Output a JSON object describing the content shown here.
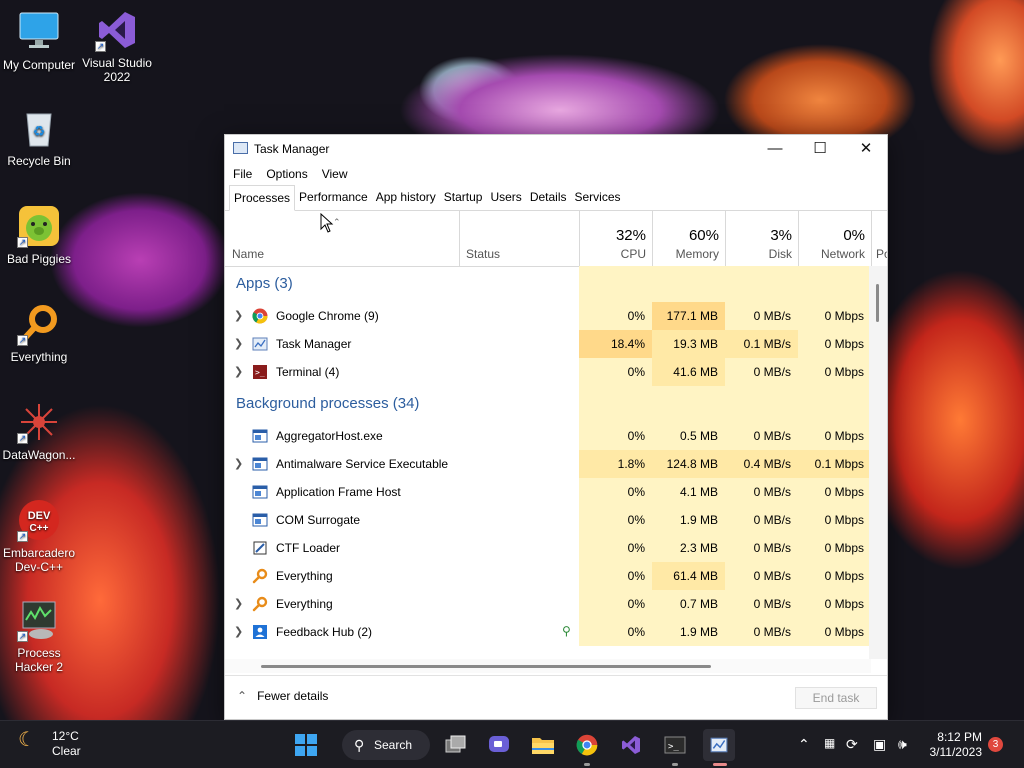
{
  "desktop": {
    "icons": [
      {
        "label": "My Computer"
      },
      {
        "label": "Visual Studio 2022"
      },
      {
        "label": "Recycle Bin"
      },
      {
        "label": "Bad Piggies"
      },
      {
        "label": "Everything"
      },
      {
        "label": "DataWagon..."
      },
      {
        "label": "Embarcadero Dev-C++"
      },
      {
        "label": "Process Hacker 2"
      }
    ]
  },
  "window": {
    "title": "Task Manager",
    "menu": [
      "File",
      "Options",
      "View"
    ],
    "tabs": [
      "Processes",
      "Performance",
      "App history",
      "Startup",
      "Users",
      "Details",
      "Services"
    ],
    "active_tab": "Processes",
    "columns": {
      "name": "Name",
      "status": "Status",
      "cpu": {
        "pct": "32%",
        "label": "CPU"
      },
      "memory": {
        "pct": "60%",
        "label": "Memory"
      },
      "disk": {
        "pct": "3%",
        "label": "Disk"
      },
      "network": {
        "pct": "0%",
        "label": "Network"
      },
      "power_partial": "Po"
    },
    "groups": {
      "apps": "Apps (3)",
      "background": "Background processes (34)"
    },
    "apps": [
      {
        "name": "Google Chrome (9)",
        "cpu": "0%",
        "mem": "177.1 MB",
        "disk": "0 MB/s",
        "net": "0 Mbps",
        "icon": "chrome-icon"
      },
      {
        "name": "Task Manager",
        "cpu": "18.4%",
        "mem": "19.3 MB",
        "disk": "0.1 MB/s",
        "net": "0 Mbps",
        "icon": "task-manager-icon"
      },
      {
        "name": "Terminal (4)",
        "cpu": "0%",
        "mem": "41.6 MB",
        "disk": "0 MB/s",
        "net": "0 Mbps",
        "icon": "terminal-icon"
      }
    ],
    "background": [
      {
        "name": "AggregatorHost.exe",
        "cpu": "0%",
        "mem": "0.5 MB",
        "disk": "0 MB/s",
        "net": "0 Mbps",
        "icon": "window-app-icon"
      },
      {
        "name": "Antimalware Service Executable",
        "cpu": "1.8%",
        "mem": "124.8 MB",
        "disk": "0.4 MB/s",
        "net": "0.1 Mbps",
        "icon": "window-app-icon"
      },
      {
        "name": "Application Frame Host",
        "cpu": "0%",
        "mem": "4.1 MB",
        "disk": "0 MB/s",
        "net": "0 Mbps",
        "icon": "window-app-icon"
      },
      {
        "name": "COM Surrogate",
        "cpu": "0%",
        "mem": "1.9 MB",
        "disk": "0 MB/s",
        "net": "0 Mbps",
        "icon": "window-app-icon"
      },
      {
        "name": "CTF Loader",
        "cpu": "0%",
        "mem": "2.3 MB",
        "disk": "0 MB/s",
        "net": "0 Mbps",
        "icon": "ctf-loader-icon"
      },
      {
        "name": "Everything",
        "cpu": "0%",
        "mem": "61.4 MB",
        "disk": "0 MB/s",
        "net": "0 Mbps",
        "icon": "everything-icon"
      },
      {
        "name": "Everything",
        "cpu": "0%",
        "mem": "0.7 MB",
        "disk": "0 MB/s",
        "net": "0 Mbps",
        "icon": "everything-icon"
      },
      {
        "name": "Feedback Hub (2)",
        "cpu": "0%",
        "mem": "1.9 MB",
        "disk": "0 MB/s",
        "net": "0 Mbps",
        "icon": "feedback-hub-icon"
      }
    ],
    "footer": {
      "fewer_details": "Fewer details",
      "end_task": "End task"
    }
  },
  "taskbar": {
    "weather": {
      "temp": "12°C",
      "condition": "Clear"
    },
    "search_label": "Search",
    "clock": {
      "time": "8:12 PM",
      "date": "3/11/2023"
    },
    "notification_count": "3"
  }
}
